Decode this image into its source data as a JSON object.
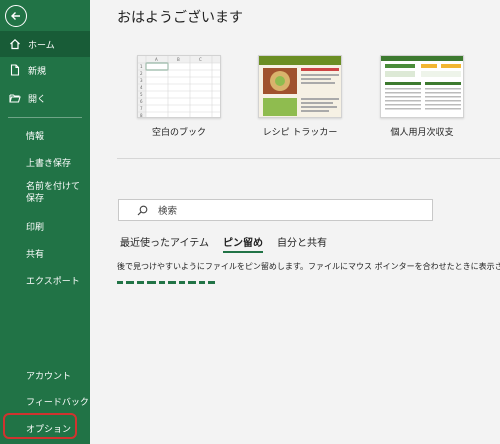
{
  "sidebar": {
    "items": [
      {
        "label": "ホーム",
        "icon": "home-icon",
        "active": true
      },
      {
        "label": "新規",
        "icon": "new-file-icon"
      },
      {
        "label": "開く",
        "icon": "open-folder-icon"
      },
      {
        "label": "情報"
      },
      {
        "label": "上書き保存"
      },
      {
        "label": "名前を付けて保存"
      },
      {
        "label": "印刷"
      },
      {
        "label": "共有"
      },
      {
        "label": "エクスポート"
      },
      {
        "label": "アカウント"
      },
      {
        "label": "フィードバック"
      },
      {
        "label": "オプション",
        "highlight_color": "#d0332f"
      }
    ]
  },
  "main": {
    "greeting": "おはようございます",
    "templates": [
      {
        "label": "空白のブック"
      },
      {
        "label": "レシピ トラッカー"
      },
      {
        "label": "個人用月次収支"
      }
    ],
    "search": {
      "placeholder": "検索"
    },
    "tabs": [
      {
        "label": "最近使ったアイテム"
      },
      {
        "label": "ピン留め",
        "active": true
      },
      {
        "label": "自分と共有"
      }
    ],
    "pinned_description": "後で見つけやすいようにファイルをピン留めします。ファイルにマウス ポインターを合わせたときに表示されるピンのアイコンをクリックします。"
  },
  "colors": {
    "accent": "#217346",
    "accent_dark": "#185c37",
    "highlight": "#d0332f"
  }
}
